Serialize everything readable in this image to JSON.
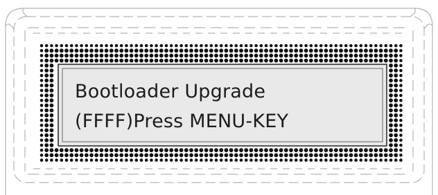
{
  "display": {
    "line1": "Bootloader Upgrade",
    "line2": "(FFFF)Press MENU-KEY"
  },
  "colors": {
    "background": "#ffffff",
    "bezel_line": "#b3b3b3",
    "dot": "#111111",
    "screen": "#e9e9e9",
    "text": "#1c1c1c"
  }
}
